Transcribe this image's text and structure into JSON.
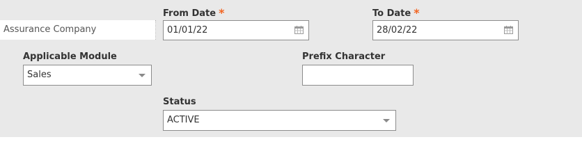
{
  "form": {
    "company_field": {
      "value": "Assurance Company"
    },
    "from_date": {
      "label": "From Date",
      "required_mark": "*",
      "value": "01/01/22",
      "icon": "calendar-icon"
    },
    "to_date": {
      "label": "To Date",
      "required_mark": "*",
      "value": "28/02/22",
      "icon": "calendar-icon"
    },
    "applicable_module": {
      "label": "Applicable Module",
      "value": "Sales",
      "icon": "chevron-down-icon"
    },
    "prefix_character": {
      "label": "Prefix Character",
      "value": ""
    },
    "status": {
      "label": "Status",
      "value": "ACTIVE",
      "icon": "chevron-down-icon"
    }
  },
  "colors": {
    "panel_bg": "#e9e9e9",
    "required_mark": "#f26522",
    "field_border": "#8c8c8c"
  }
}
